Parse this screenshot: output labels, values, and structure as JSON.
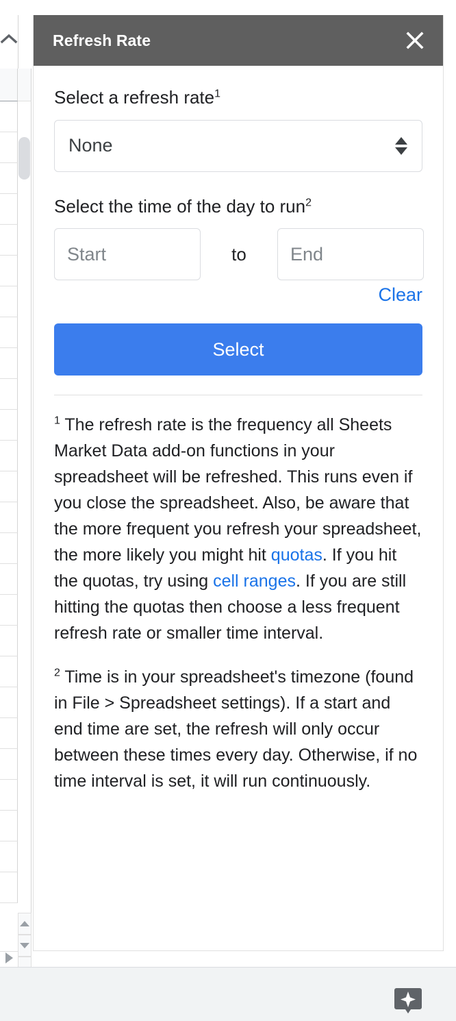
{
  "panel": {
    "title": "Refresh Rate",
    "close_icon": "close-icon",
    "refresh_rate": {
      "label": "Select a refresh rate",
      "label_sup": "1",
      "selected_value": "None",
      "spinner_icon": "spinner-up-down-icon"
    },
    "time_of_day": {
      "label": "Select the time of the day to run",
      "label_sup": "2",
      "start_placeholder": "Start",
      "start_value": "",
      "separator": "to",
      "end_placeholder": "End",
      "end_value": "",
      "clear_label": "Clear"
    },
    "submit_label": "Select",
    "footnotes": [
      {
        "marker": "1",
        "part1": " The refresh rate is the frequency all Sheets Market Data add-on functions in your spreadsheet will be refreshed. This runs even if you close the spreadsheet. Also, be aware that the more frequent you refresh your spreadsheet, the more likely you might hit ",
        "link1": "quotas",
        "part2": ". If you hit the quotas, try using ",
        "link2": "cell ranges",
        "part3": ". If you are still hitting the quotas then choose a less frequent refresh rate or smaller time interval."
      },
      {
        "marker": "2",
        "text": " Time is in your spreadsheet's timezone (found in File > Spreadsheet settings). If a start and end time are set, the refresh will only occur between these times every day. Otherwise, if no time interval is set, it will run continuously."
      }
    ]
  },
  "spreadsheet": {
    "collapse_icon": "chevron-up-icon",
    "scroll_up_icon": "triangle-up-icon",
    "scroll_down_icon": "triangle-down-icon",
    "sheet_play_icon": "triangle-right-icon",
    "scrollbar": "vertical-scrollbar"
  },
  "footer": {
    "assistant_icon": "sparkle-badge-icon"
  },
  "colors": {
    "header_bg": "#5f5f5f",
    "accent_blue": "#3b7ded",
    "link_blue": "#1a73e8",
    "footer_bg": "#f1f3f4"
  }
}
